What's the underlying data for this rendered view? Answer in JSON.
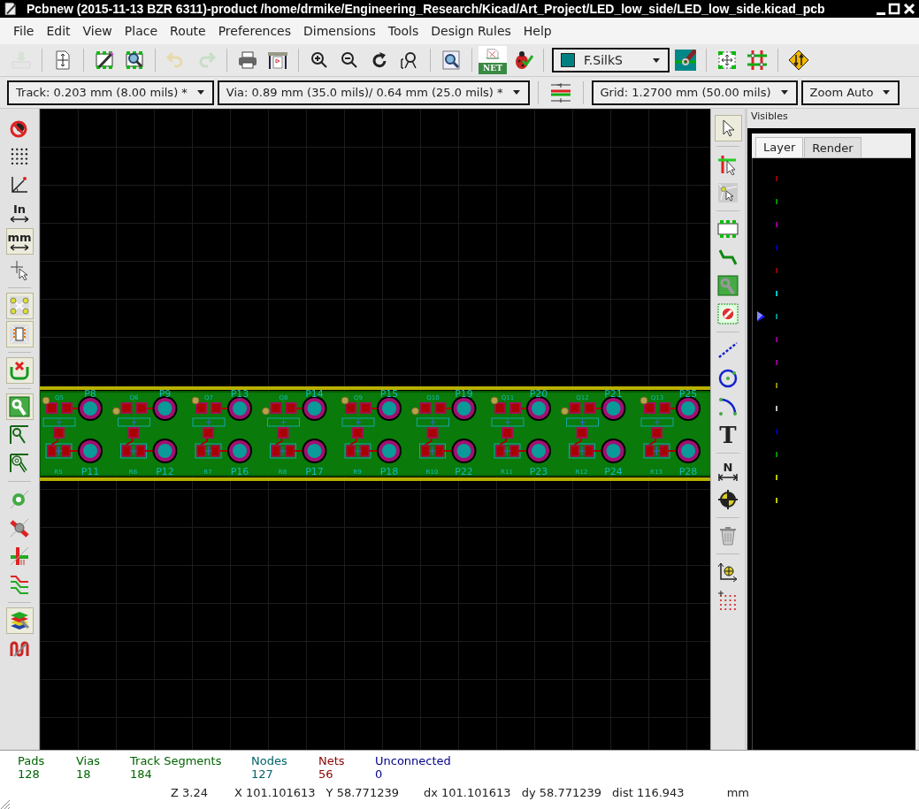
{
  "window": {
    "title": "Pcbnew (2015-11-13 BZR 6311)-product /home/drmike/Engineering_Research/Kicad/Art_Project/LED_low_side/LED_low_side.kicad_pcb"
  },
  "menu": [
    "File",
    "Edit",
    "View",
    "Place",
    "Route",
    "Preferences",
    "Dimensions",
    "Tools",
    "Design Rules",
    "Help"
  ],
  "main_toolbar": [
    {
      "kind": "tray",
      "disabled": true
    },
    {
      "kind": "separator"
    },
    {
      "kind": "page",
      "disabled": false
    },
    {
      "kind": "separator"
    },
    {
      "kind": "chip-pencil",
      "disabled": false
    },
    {
      "kind": "chip-magnifier",
      "disabled": false
    },
    {
      "kind": "separator"
    },
    {
      "kind": "undo",
      "disabled": true
    },
    {
      "kind": "redo",
      "disabled": true
    },
    {
      "kind": "separator"
    },
    {
      "kind": "printer",
      "disabled": false
    },
    {
      "kind": "plotter",
      "disabled": false
    },
    {
      "kind": "separator"
    },
    {
      "kind": "zoom-in",
      "disabled": false
    },
    {
      "kind": "zoom-out",
      "disabled": false
    },
    {
      "kind": "redraw",
      "disabled": false
    },
    {
      "kind": "zoom-fit",
      "disabled": false
    },
    {
      "kind": "separator"
    },
    {
      "kind": "find",
      "disabled": false
    },
    {
      "kind": "separator"
    },
    {
      "kind": "net",
      "label": "NET",
      "disabled": false
    },
    {
      "kind": "ladybug",
      "disabled": false
    },
    {
      "kind": "separator"
    },
    {
      "kind": "layer-select",
      "label": "F.SilkS"
    },
    {
      "kind": "track-via",
      "disabled": false
    },
    {
      "kind": "separator"
    },
    {
      "kind": "chip-arrows",
      "disabled": false
    },
    {
      "kind": "grid-hash",
      "disabled": false
    },
    {
      "kind": "separator"
    },
    {
      "kind": "diamond",
      "disabled": false
    }
  ],
  "options_toolbar": [
    {
      "kind": "dropdown",
      "label": "Track: 0.203 mm (8.00 mils) *"
    },
    {
      "kind": "dropdown",
      "label": "Via: 0.89 mm (35.0 mils)/ 0.64 mm (25.0 mils) *"
    },
    {
      "kind": "separator"
    },
    {
      "kind": "track-width-icon"
    },
    {
      "kind": "separator"
    },
    {
      "kind": "dropdown",
      "label": "Grid: 1.2700 mm (50.00 mils)"
    },
    {
      "kind": "dropdown",
      "label": "Zoom Auto"
    }
  ],
  "left_toolbar": [
    {
      "kind": "bug-off",
      "pressed": false
    },
    {
      "kind": "dots",
      "pressed": false
    },
    {
      "kind": "polar",
      "pressed": false
    },
    {
      "kind": "inch",
      "label": "In",
      "pressed": false
    },
    {
      "kind": "mm",
      "label": "mm",
      "pressed": true
    },
    {
      "kind": "cursor-cross",
      "pressed": false
    },
    {
      "kind": "separator"
    },
    {
      "kind": "ratsnest",
      "pressed": true
    },
    {
      "kind": "chip-ratsnest",
      "pressed": true
    },
    {
      "kind": "separator"
    },
    {
      "kind": "no-connect",
      "pressed": true
    },
    {
      "kind": "separator"
    },
    {
      "kind": "pad-filled",
      "pressed": true
    },
    {
      "kind": "pad-outline",
      "pressed": false
    },
    {
      "kind": "pad-sketch",
      "pressed": false
    },
    {
      "kind": "separator"
    },
    {
      "kind": "via-sketch",
      "pressed": false
    },
    {
      "kind": "track-sketch",
      "pressed": false
    },
    {
      "kind": "contrast",
      "pressed": false
    },
    {
      "kind": "zone-double",
      "pressed": false
    },
    {
      "kind": "separator"
    },
    {
      "kind": "layers-wrench",
      "pressed": true
    },
    {
      "kind": "wrench-coil",
      "pressed": false
    }
  ],
  "right_toolbar": [
    {
      "kind": "arrow",
      "pressed": true
    },
    {
      "kind": "separator"
    },
    {
      "kind": "net-highlight",
      "pressed": false
    },
    {
      "kind": "local-ratsnest",
      "pressed": false
    },
    {
      "kind": "separator"
    },
    {
      "kind": "module",
      "pressed": false
    },
    {
      "kind": "track",
      "pressed": false
    },
    {
      "kind": "via-add",
      "pressed": false
    },
    {
      "kind": "keepout",
      "pressed": false
    },
    {
      "kind": "separator"
    },
    {
      "kind": "line",
      "pressed": false
    },
    {
      "kind": "circle",
      "pressed": false
    },
    {
      "kind": "arc",
      "pressed": false
    },
    {
      "kind": "text",
      "label": "T",
      "pressed": false
    },
    {
      "kind": "separator"
    },
    {
      "kind": "dimension",
      "label": "N",
      "pressed": false
    },
    {
      "kind": "target",
      "pressed": false
    },
    {
      "kind": "separator"
    },
    {
      "kind": "trash",
      "pressed": false
    },
    {
      "kind": "separator"
    },
    {
      "kind": "origin",
      "pressed": false
    },
    {
      "kind": "grid-origin",
      "pressed": false
    }
  ],
  "board": {
    "units": [
      {
        "q": "Q5",
        "r": "R5",
        "top_pad": "P8",
        "bottom_pad": "P11"
      },
      {
        "q": "Q6",
        "r": "R6",
        "top_pad": "P9",
        "bottom_pad": "P12"
      },
      {
        "q": "Q7",
        "r": "R7",
        "top_pad": "P13",
        "bottom_pad": "P16"
      },
      {
        "q": "Q8",
        "r": "R8",
        "top_pad": "P14",
        "bottom_pad": "P17"
      },
      {
        "q": "Q9",
        "r": "R9",
        "top_pad": "P15",
        "bottom_pad": "P18"
      },
      {
        "q": "Q10",
        "r": "R10",
        "top_pad": "P19",
        "bottom_pad": "P22"
      },
      {
        "q": "Q11",
        "r": "R11",
        "top_pad": "P20",
        "bottom_pad": "P23"
      },
      {
        "q": "Q12",
        "r": "R12",
        "top_pad": "P21",
        "bottom_pad": "P24"
      },
      {
        "q": "Q13",
        "r": "R13",
        "top_pad": "P25",
        "bottom_pad": "P28"
      }
    ]
  },
  "layers_panel": {
    "caption": "Visibles",
    "tabs": [
      {
        "label": "Layer",
        "selected": true
      },
      {
        "label": "Render",
        "selected": false
      }
    ],
    "layers": [
      {
        "color": "#8b0000",
        "selected": false
      },
      {
        "color": "#008b00",
        "selected": false
      },
      {
        "color": "#8b008b",
        "selected": false
      },
      {
        "color": "#00008b",
        "selected": false
      },
      {
        "color": "#8b0000",
        "selected": false
      },
      {
        "color": "#00c2c2",
        "selected": false
      },
      {
        "color": "#008b8b",
        "selected": true
      },
      {
        "color": "#8b008b",
        "selected": false
      },
      {
        "color": "#8b008b",
        "selected": false
      },
      {
        "color": "#8b8b00",
        "selected": false
      },
      {
        "color": "#c2c2c2",
        "selected": false
      },
      {
        "color": "#00008b",
        "selected": false
      },
      {
        "color": "#008b00",
        "selected": false
      },
      {
        "color": "#c2c200",
        "selected": false
      },
      {
        "color": "#c2c200",
        "selected": false
      }
    ]
  },
  "stats": [
    {
      "label": "Pads",
      "value": "128",
      "color": "#006400"
    },
    {
      "label": "Vias",
      "value": "18",
      "color": "#006400"
    },
    {
      "label": "Track Segments",
      "value": "184",
      "color": "#006400"
    },
    {
      "label": "Nodes",
      "value": "127",
      "color": "#00646b"
    },
    {
      "label": "Nets",
      "value": "56",
      "color": "#8b0000"
    },
    {
      "label": "Unconnected",
      "value": "0",
      "color": "#00008b"
    }
  ],
  "status_fields": [
    "Z 3.24",
    "X 101.101613",
    "Y 58.771239",
    "dx 101.101613",
    "dy 58.771239",
    "dist 116.943",
    "mm"
  ]
}
